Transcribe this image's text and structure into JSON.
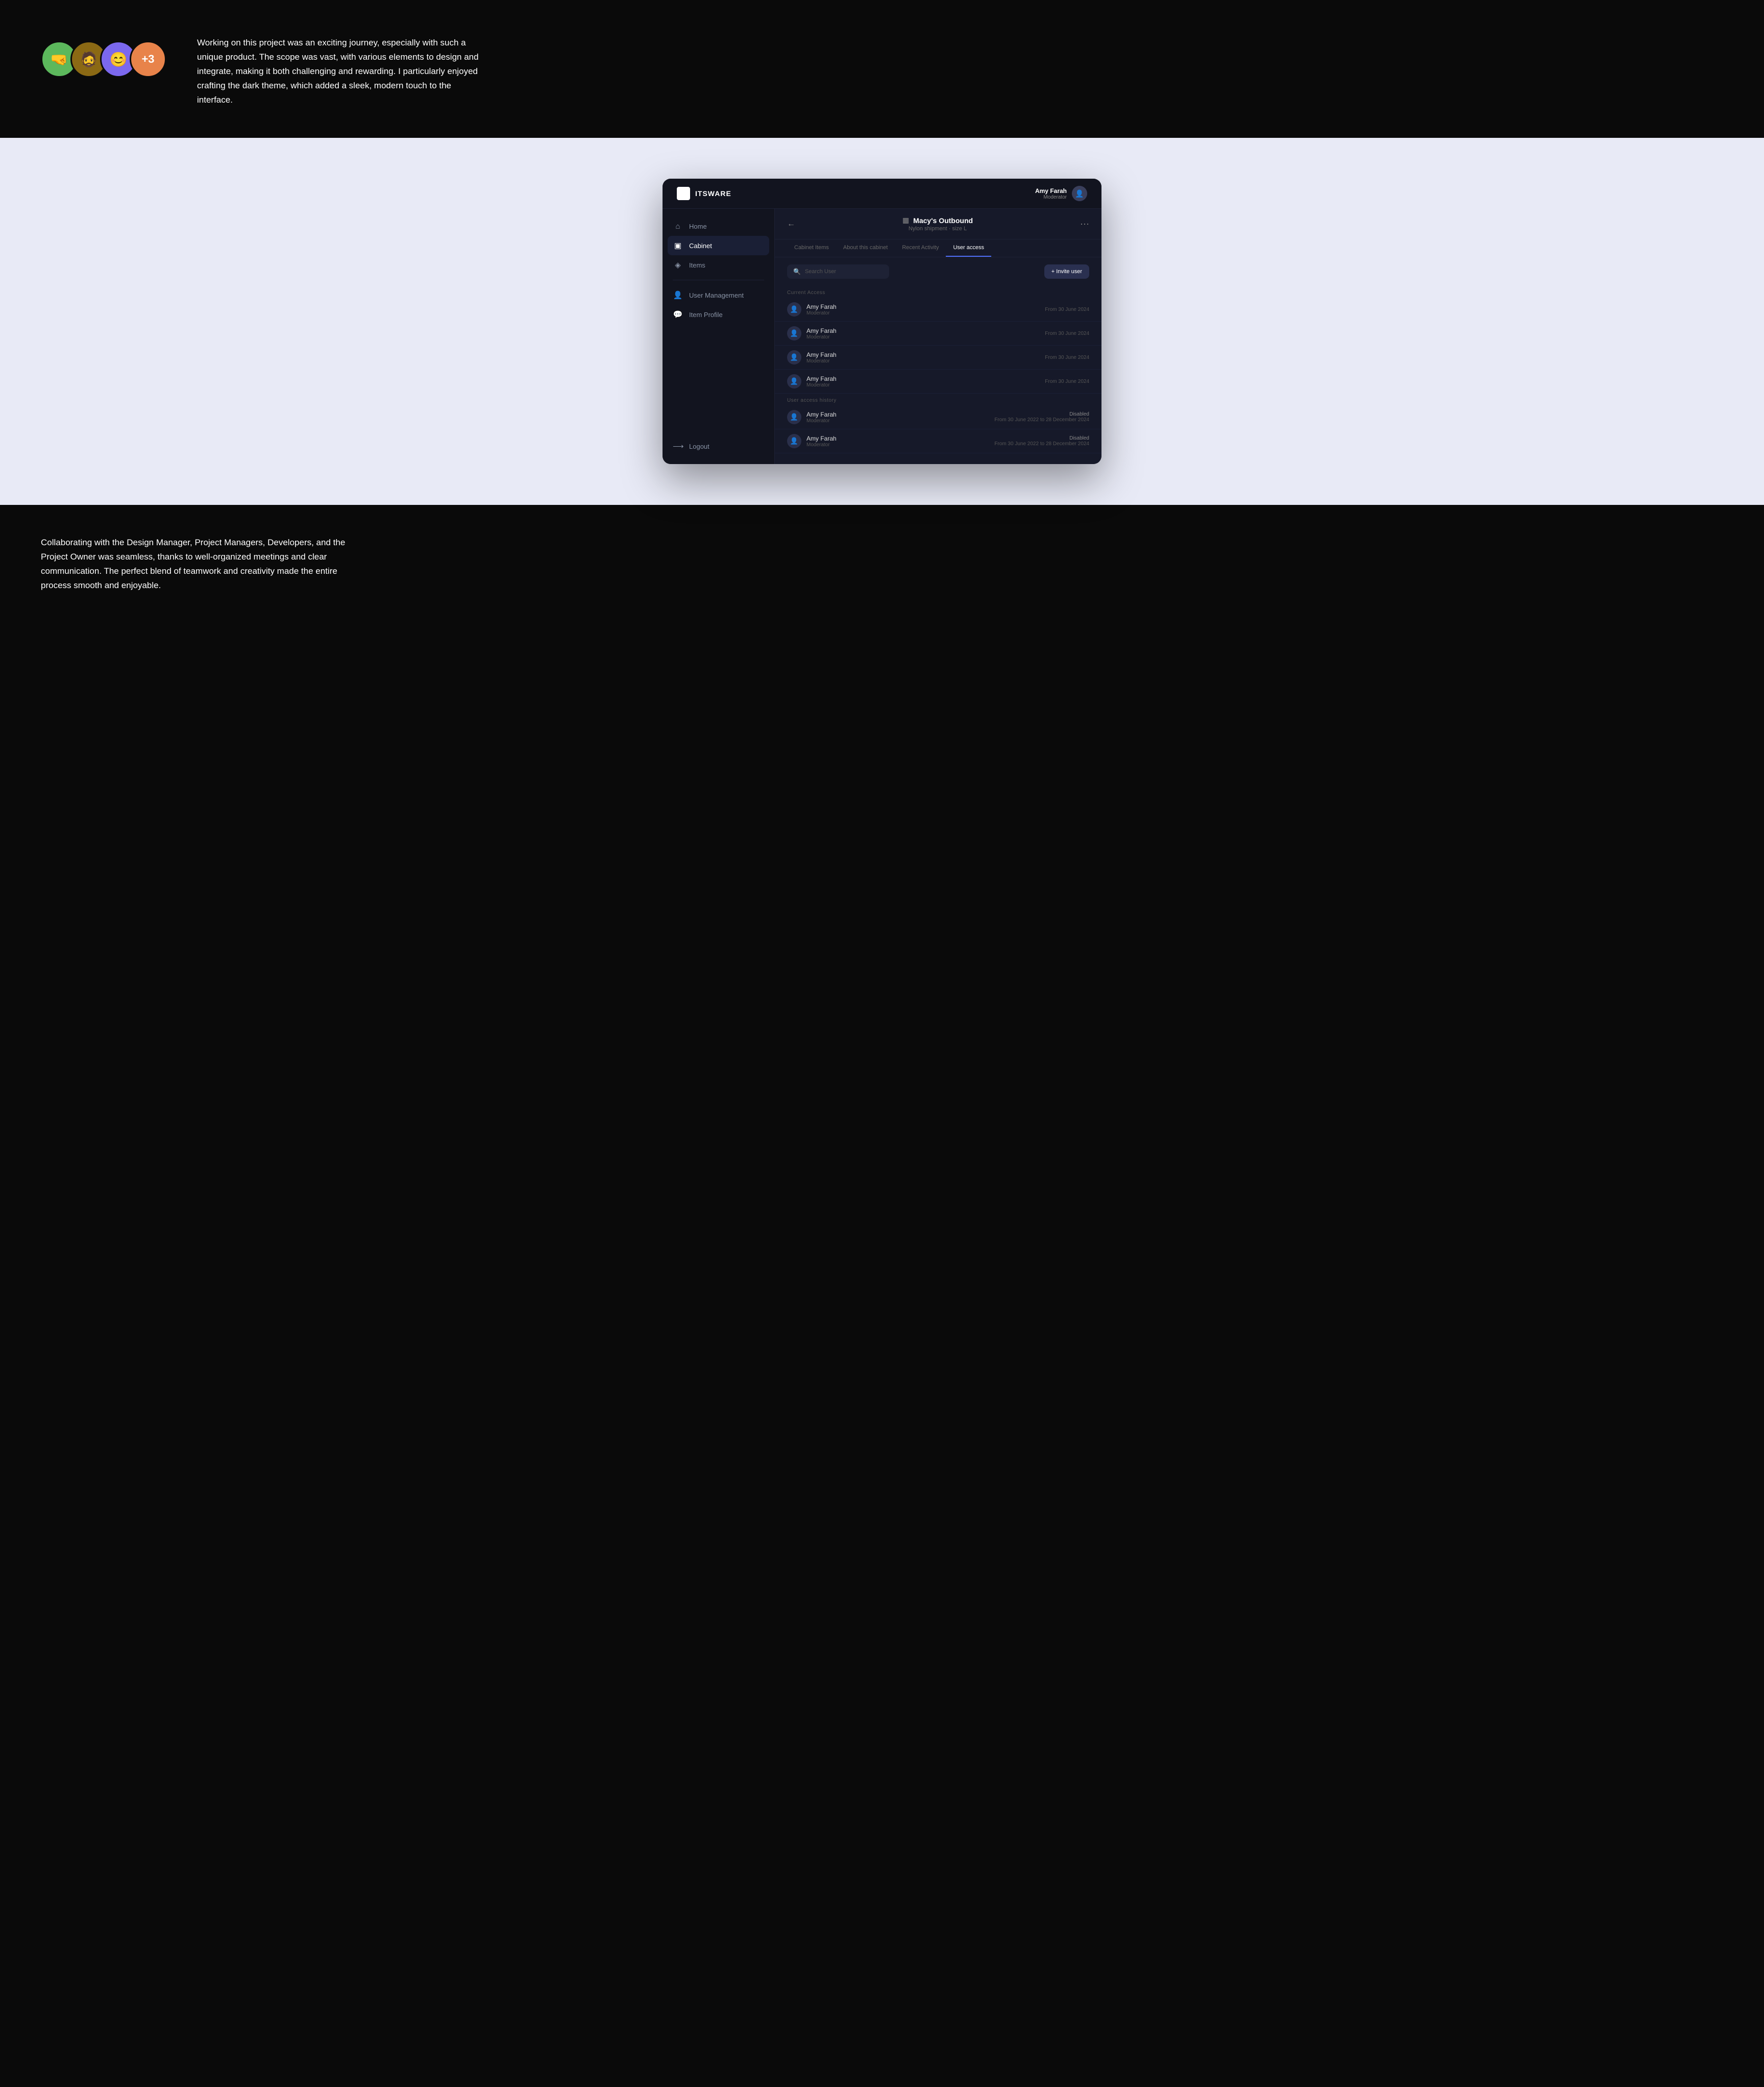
{
  "top": {
    "avatars": [
      {
        "id": "a1",
        "emoji": "🤜",
        "bg": "#5cb85c"
      },
      {
        "id": "a2",
        "emoji": "🧔",
        "bg": "#8B6914"
      },
      {
        "id": "a3",
        "emoji": "😊",
        "bg": "#7B68EE"
      }
    ],
    "more_count": "+3",
    "description": "Working on this project was an exciting journey, especially with such a unique product. The scope was vast, with various elements to design and integrate, making it both challenging and rewarding. I particularly enjoyed crafting the dark theme, which added a sleek, modern touch to the interface."
  },
  "app": {
    "logo_text": "ITSWARE",
    "header_user": {
      "name": "Amy Farah",
      "role": "Moderator"
    },
    "sidebar": {
      "items": [
        {
          "label": "Home",
          "icon": "⌂",
          "active": false
        },
        {
          "label": "Cabinet",
          "icon": "▣",
          "active": true
        },
        {
          "label": "Items",
          "icon": "◈",
          "active": false
        },
        {
          "label": "User Management",
          "icon": "👤",
          "active": false
        },
        {
          "label": "Item Profile",
          "icon": "💬",
          "active": false
        },
        {
          "label": "Logout",
          "icon": "→",
          "active": false
        }
      ]
    },
    "cabinet": {
      "title": "Macy's Outbound",
      "subtitle": "Nylon shipment · size L",
      "tabs": [
        "Cabinet Items",
        "About this cabinet",
        "Recent Activity",
        "User access"
      ],
      "active_tab": "User access",
      "search_placeholder": "Search User",
      "invite_button": "+ Invite user",
      "current_access_label": "Current Access",
      "history_label": "User access history",
      "current_users": [
        {
          "name": "Amy Farah",
          "role": "Moderator",
          "date": "From 30 June 2024"
        },
        {
          "name": "Amy Farah",
          "role": "Moderator",
          "date": "From 30 June 2024"
        },
        {
          "name": "Amy Farah",
          "role": "Moderator",
          "date": "From 30 June 2024"
        },
        {
          "name": "Amy Farah",
          "role": "Moderator",
          "date": "From 30 June 2024"
        }
      ],
      "history_users": [
        {
          "name": "Amy Farah",
          "role": "Moderator",
          "status": "Disabled",
          "date": "From 30 June 2022 to 28 December 2024"
        },
        {
          "name": "Amy Farah",
          "role": "Moderator",
          "status": "Disabled",
          "date": "From 30 June 2022 to 28 December 2024"
        }
      ]
    }
  },
  "bottom": {
    "text": "Collaborating with the Design Manager, Project Managers, Developers, and the Project Owner was seamless, thanks to well-organized meetings and clear communication. The perfect blend of teamwork and creativity made the entire process smooth and enjoyable."
  }
}
